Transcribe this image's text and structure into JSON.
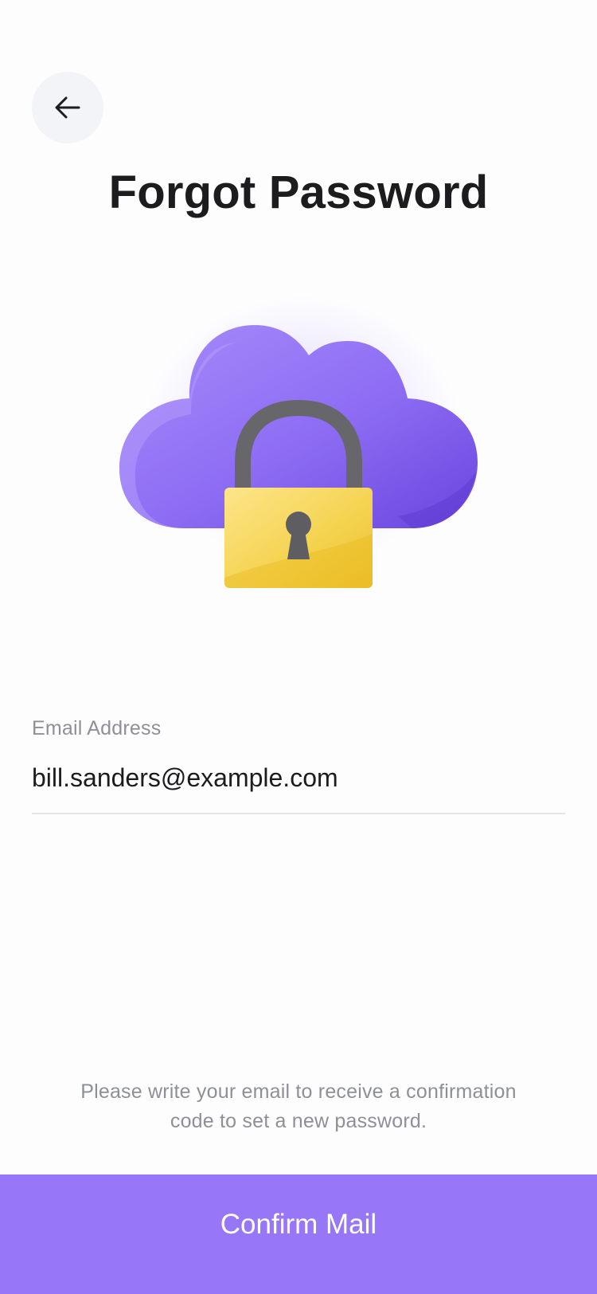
{
  "header": {
    "back_icon": "arrow-left-icon",
    "title": "Forgot Password"
  },
  "illustration": {
    "icons": [
      "cloud-icon",
      "padlock-icon"
    ],
    "colors": {
      "cloud_light": "#a78cfb",
      "cloud_dark": "#6a45de",
      "lock_light": "#fde58a",
      "lock_dark": "#ecc02a",
      "shackle": "#6b6b6f"
    }
  },
  "form": {
    "email_label": "Email Address",
    "email_value": "bill.sanders@example.com"
  },
  "footer": {
    "help_text": "Please write your email to receive a confirmation code to set a new password.",
    "confirm_label": "Confirm Mail"
  },
  "colors": {
    "accent": "#9777f8",
    "title": "#1c1c1e",
    "muted": "#8e9097"
  }
}
